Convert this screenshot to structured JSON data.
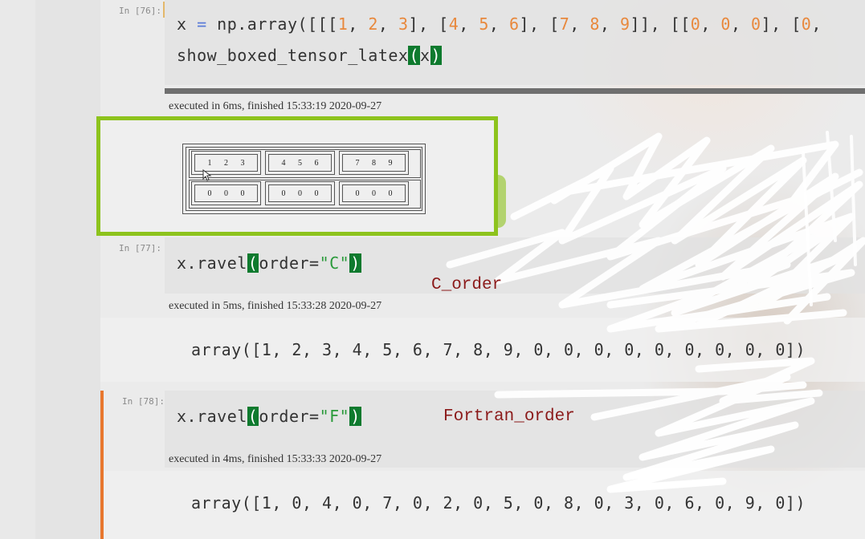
{
  "cells": [
    {
      "prompt": "In [76]:",
      "line1": {
        "pre": "x ",
        "eq": "=",
        "mid": " np.array([[[",
        "n1": "1",
        "c1": ", ",
        "n2": "2",
        "c2": ", ",
        "n3": "3",
        "c3": "], [",
        "n4": "4",
        "c4": ", ",
        "n5": "5",
        "c5": ", ",
        "n6": "6",
        "c6": "], [",
        "n7": "7",
        "c7": ", ",
        "n8": "8",
        "c8": ", ",
        "n9": "9",
        "c9": "]], [[",
        "n10": "0",
        "c10": ", ",
        "n11": "0",
        "c11": ", ",
        "n12": "0",
        "c12": "], [",
        "n13": "0",
        "c13": ","
      },
      "line2": {
        "fn": "show_boxed_tensor_latex",
        "open": "(",
        "arg": "x",
        "close": ")"
      },
      "exec": "executed in 6ms, finished 15:33:19 2020-09-27",
      "tensor": [
        [
          [
            "1",
            "2",
            "3"
          ],
          [
            "4",
            "5",
            "6"
          ],
          [
            "7",
            "8",
            "9"
          ]
        ],
        [
          [
            "0",
            "0",
            "0"
          ],
          [
            "0",
            "0",
            "0"
          ],
          [
            "0",
            "0",
            "0"
          ]
        ]
      ]
    },
    {
      "prompt": "In [77]:",
      "code": {
        "fn": "x.ravel",
        "open": "(",
        "kw": "order=",
        "str": "\"C\"",
        "close": ")"
      },
      "exec": "executed in 5ms, finished 15:33:28 2020-09-27",
      "output": "array([1, 2, 3, 4, 5, 6, 7, 8, 9, 0, 0, 0, 0, 0, 0, 0, 0, 0])",
      "annotation": "C_order"
    },
    {
      "prompt": "In [78]:",
      "code": {
        "fn": "x.ravel",
        "open": "(",
        "kw": "order=",
        "str": "\"F\"",
        "close": ")"
      },
      "exec": "executed in 4ms, finished 15:33:33 2020-09-27",
      "output": "array([1, 0, 4, 0, 7, 0, 2, 0, 5, 0, 8, 0, 3, 0, 6, 0, 9, 0])",
      "annotation": "Fortran_order"
    }
  ],
  "colors": {
    "highlight_box": "#8dc31d",
    "selected_cell_border": "#e8772e",
    "annotation_ink": "#8b1a1a",
    "number": "#e8883c",
    "string": "#2a9a3a",
    "matched_paren_bg": "#0e7a2e"
  },
  "icons": {
    "cursor": "mouse-pointer-icon"
  }
}
